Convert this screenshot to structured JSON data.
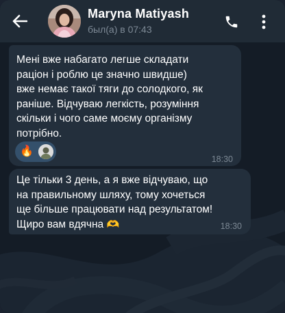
{
  "header": {
    "contact_name": "Maryna Matiyash",
    "last_seen": "был(а) в 07:43",
    "icons": [
      "back-arrow-icon",
      "phone-icon",
      "more-vertical-icon"
    ]
  },
  "messages": [
    {
      "text": "Мені вже набагато легше складати\nраціон і роблю це значно швидше)\nвже немає такої тяги до солодкого, як\nраніше. Відчуваю легкість, розуміння\nскільки і чого саме моєму організму\nпотрібно.",
      "time": "18:30",
      "reaction_emoji": "🔥"
    },
    {
      "text": "Це тільки 3 день, а я вже відчуваю, що\nна правильному шляху, тому хочеться\nще більше працювати над результатом!\nЩиро вам вдячна",
      "emoji": "🫶",
      "time": "18:30"
    }
  ],
  "colors": {
    "header_bg": "#202b36",
    "bubble_bg": "#232f3c",
    "chat_bg": "#141c26",
    "reaction_bg": "#34506b",
    "muted_text": "#7c8894"
  }
}
